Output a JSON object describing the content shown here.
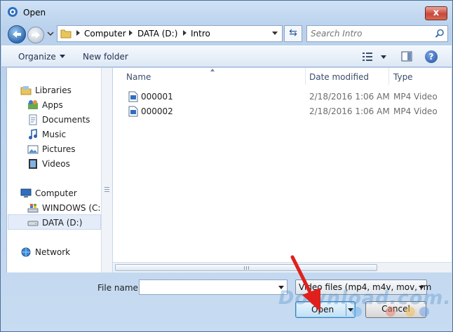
{
  "window": {
    "title": "Open",
    "close_label": "x"
  },
  "address": {
    "crumbs": [
      "Computer",
      "DATA (D:)",
      "Intro"
    ]
  },
  "search": {
    "placeholder": "Search Intro"
  },
  "toolbar": {
    "organize_label": "Organize",
    "new_folder_label": "New folder",
    "help_label": "?"
  },
  "sidebar": {
    "items": [
      {
        "label": "Libraries",
        "icon": "libraries-icon"
      },
      {
        "label": "Apps",
        "icon": "apps-icon"
      },
      {
        "label": "Documents",
        "icon": "documents-icon"
      },
      {
        "label": "Music",
        "icon": "music-icon"
      },
      {
        "label": "Pictures",
        "icon": "pictures-icon"
      },
      {
        "label": "Videos",
        "icon": "videos-icon"
      },
      {
        "label": "Computer",
        "icon": "computer-icon"
      },
      {
        "label": "WINDOWS (C:)",
        "icon": "windows-drive-icon"
      },
      {
        "label": "DATA (D:)",
        "icon": "drive-icon",
        "selected": true
      },
      {
        "label": "Network",
        "icon": "network-icon"
      }
    ]
  },
  "files": {
    "columns": [
      "Name",
      "Date modified",
      "Type"
    ],
    "rows": [
      {
        "name": "000001",
        "date": "2/18/2016 1:06 AM",
        "type": "MP4 Video"
      },
      {
        "name": "000002",
        "date": "2/18/2016 1:06 AM",
        "type": "MP4 Video"
      }
    ]
  },
  "bottom": {
    "file_name_label": "File name:",
    "file_name_value": "",
    "file_type_value": "Video files (mp4, m4v, mov, rm",
    "open_label": "Open",
    "cancel_label": "Cancel"
  },
  "watermark": {
    "text": "Download.com.vn"
  },
  "colors": {
    "accent": "#3c7fb1",
    "titlebar": "#cfe1f5",
    "close": "#c9473a",
    "arrow": "#e0201c"
  }
}
